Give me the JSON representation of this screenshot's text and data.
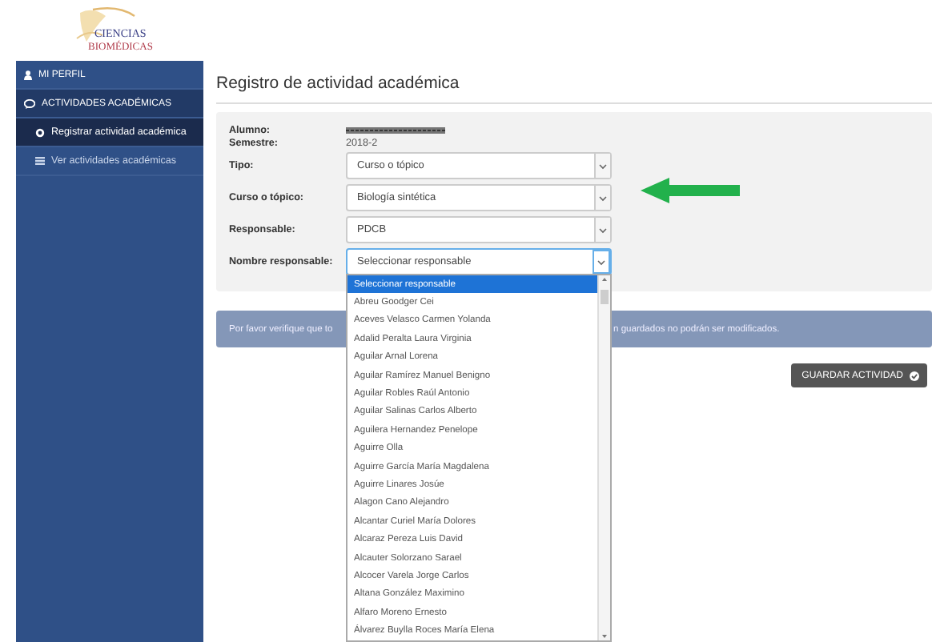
{
  "logo": {
    "lines": [
      "CIENCIAS",
      "BIOMÉDICAS"
    ]
  },
  "sidebar": {
    "items": [
      {
        "label": "MI PERFIL",
        "selected": false
      },
      {
        "label": "ACTIVIDADES ACADÉMICAS",
        "selected": false,
        "children": [
          {
            "label": "Registrar actividad académica",
            "selected": true
          },
          {
            "label": "Ver actividades académicas",
            "selected": false
          }
        ]
      }
    ]
  },
  "page_title": "Registro de actividad académica",
  "form": {
    "fields": [
      {
        "kind": "redacted",
        "label": "Alumno:"
      },
      {
        "kind": "text",
        "label": "Semestre:",
        "value": "2018-2"
      },
      {
        "kind": "select",
        "label": "Tipo:",
        "value": "Curso o tópico",
        "focused": false
      },
      {
        "kind": "select",
        "label": "Curso o tópico:",
        "value": "Biología sintética",
        "focused": false
      },
      {
        "kind": "select",
        "label": "Responsable:",
        "value": "PDCB",
        "focused": false
      },
      {
        "kind": "select",
        "label": "Nombre responsable:",
        "value": "Seleccionar responsable",
        "focused": true,
        "expanded": true
      }
    ]
  },
  "dropdown": {
    "options": [
      {
        "label": "Seleccionar responsable",
        "selected": true
      },
      {
        "label": "Abreu Goodger Cei",
        "selected": false
      },
      {
        "label": "Aceves Velasco Carmen Yolanda",
        "selected": false
      },
      {
        "label": "Adalid Peralta Laura Virginia",
        "selected": false
      },
      {
        "label": "Aguilar Arnal Lorena",
        "selected": false
      },
      {
        "label": "Aguilar Ramírez Manuel Benigno",
        "selected": false
      },
      {
        "label": "Aguilar Robles Raúl Antonio",
        "selected": false
      },
      {
        "label": "Aguilar Salinas Carlos Alberto",
        "selected": false
      },
      {
        "label": "Aguilera Hernandez Penelope",
        "selected": false
      },
      {
        "label": "Aguirre Olla",
        "selected": false
      },
      {
        "label": "Aguirre García María Magdalena",
        "selected": false
      },
      {
        "label": "Aguirre Linares Josúe",
        "selected": false
      },
      {
        "label": "Alagon Cano Alejandro",
        "selected": false
      },
      {
        "label": "Alcantar Curiel María Dolores",
        "selected": false
      },
      {
        "label": "Alcaraz Pereza Luis David",
        "selected": false
      },
      {
        "label": "Alcauter Solorzano Sarael",
        "selected": false
      },
      {
        "label": "Alcocer Varela Jorge Carlos",
        "selected": false
      },
      {
        "label": "Altana González Maximino",
        "selected": false
      },
      {
        "label": "Alfaro Moreno Ernesto",
        "selected": false
      },
      {
        "label": "Álvarez Buylla Roces María Elena",
        "selected": false
      }
    ]
  },
  "alert": {
    "text_before": "Por favor verifique que to",
    "text_after": "n guardados no podrán ser modificados."
  },
  "save_button": {
    "label": "GUARDAR ACTIVIDAD"
  }
}
